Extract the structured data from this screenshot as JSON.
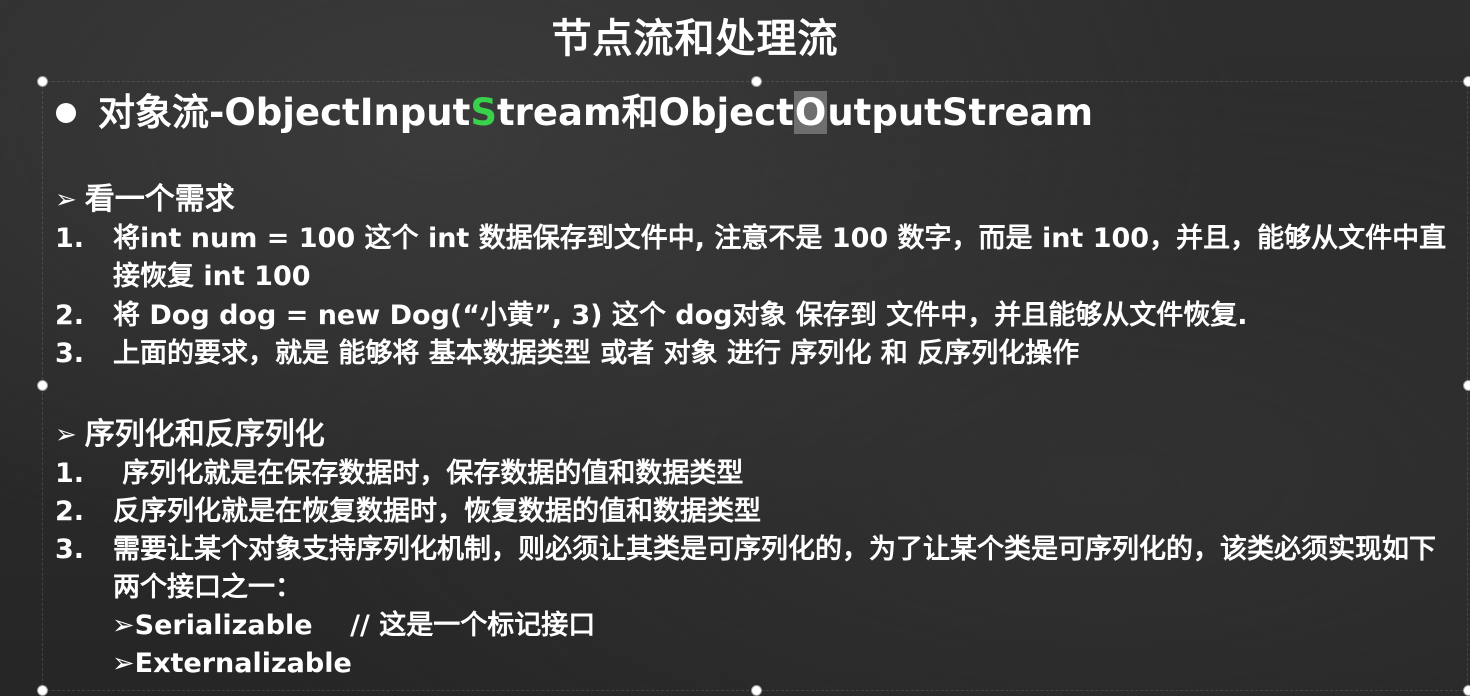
{
  "title": "节点流和处理流",
  "main_bullet": {
    "part1": "对象流-ObjectInput",
    "green_char": "S",
    "part2": "tream和Object",
    "boxed_char": "O",
    "part3": "utputStream"
  },
  "section1": {
    "marker": "➢",
    "heading": "看一个需求",
    "items": [
      {
        "num": "1.",
        "text": "将int num = 100 这个 int 数据保存到文件中, 注意不是 100 数字，而是 int 100，并且，能够从文件中直接恢复 int 100"
      },
      {
        "num": "2.",
        "text": "将 Dog dog = new Dog(“小黄”, 3) 这个 dog对象 保存到 文件中，并且能够从文件恢复."
      },
      {
        "num": "3.",
        "text": "上面的要求，就是 能够将 基本数据类型 或者 对象 进行 序列化 和 反序列化操作"
      }
    ]
  },
  "section2": {
    "marker": "➢",
    "heading": "序列化和反序列化",
    "items": [
      {
        "num": "1.",
        "text": " 序列化就是在保存数据时，保存数据的值和数据类型"
      },
      {
        "num": "2.",
        "text": "反序列化就是在恢复数据时，恢复数据的值和数据类型"
      },
      {
        "num": "3.",
        "text": "需要让某个对象支持序列化机制，则必须让其类是可序列化的，为了让某个类是可序列化的，该类必须实现如下两个接口之一："
      }
    ],
    "subitems": [
      "➢Serializable    // 这是一个标记接口",
      "➢Externalizable"
    ]
  }
}
